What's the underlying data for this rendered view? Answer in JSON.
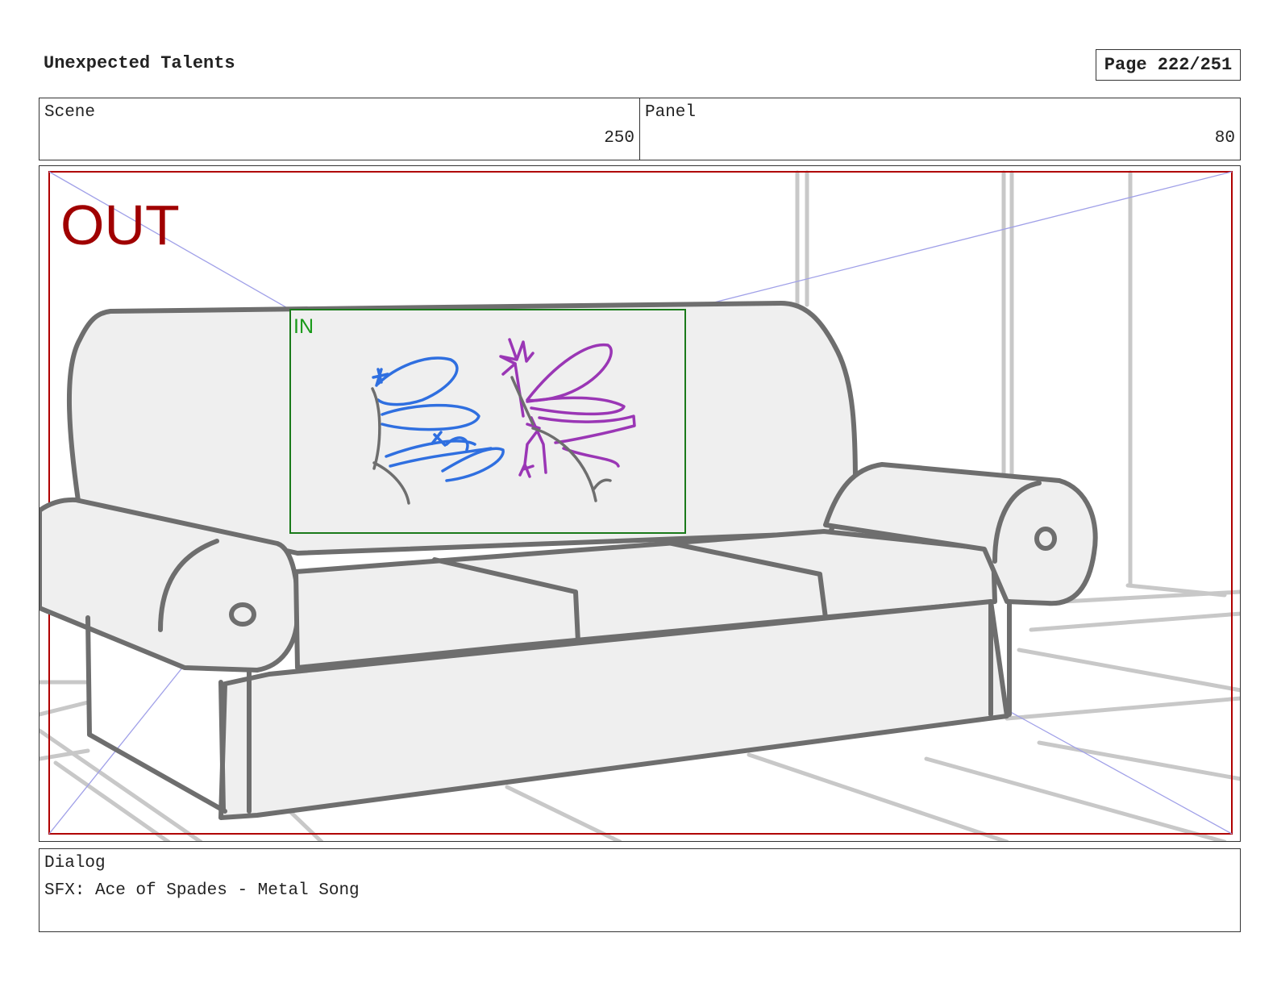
{
  "document": {
    "title": "Unexpected Talents",
    "page_label": "Page 222/251"
  },
  "info": {
    "scene_label": "Scene",
    "scene_value": "250",
    "panel_label": "Panel",
    "panel_value": "80"
  },
  "panel": {
    "out_label": "OUT",
    "in_label": "IN",
    "colors": {
      "out_frame": "#b00000",
      "in_frame": "#1a7a1a",
      "guides": "#a0a0e8",
      "blue_character": "#2f6fe0",
      "purple_character": "#9a36b5",
      "sofa_line": "#6e6e6e",
      "sofa_fill": "#efefef",
      "background_lines": "#c8c8c8"
    }
  },
  "dialog": {
    "label": "Dialog",
    "text": "SFX: Ace of Spades - Metal Song"
  }
}
